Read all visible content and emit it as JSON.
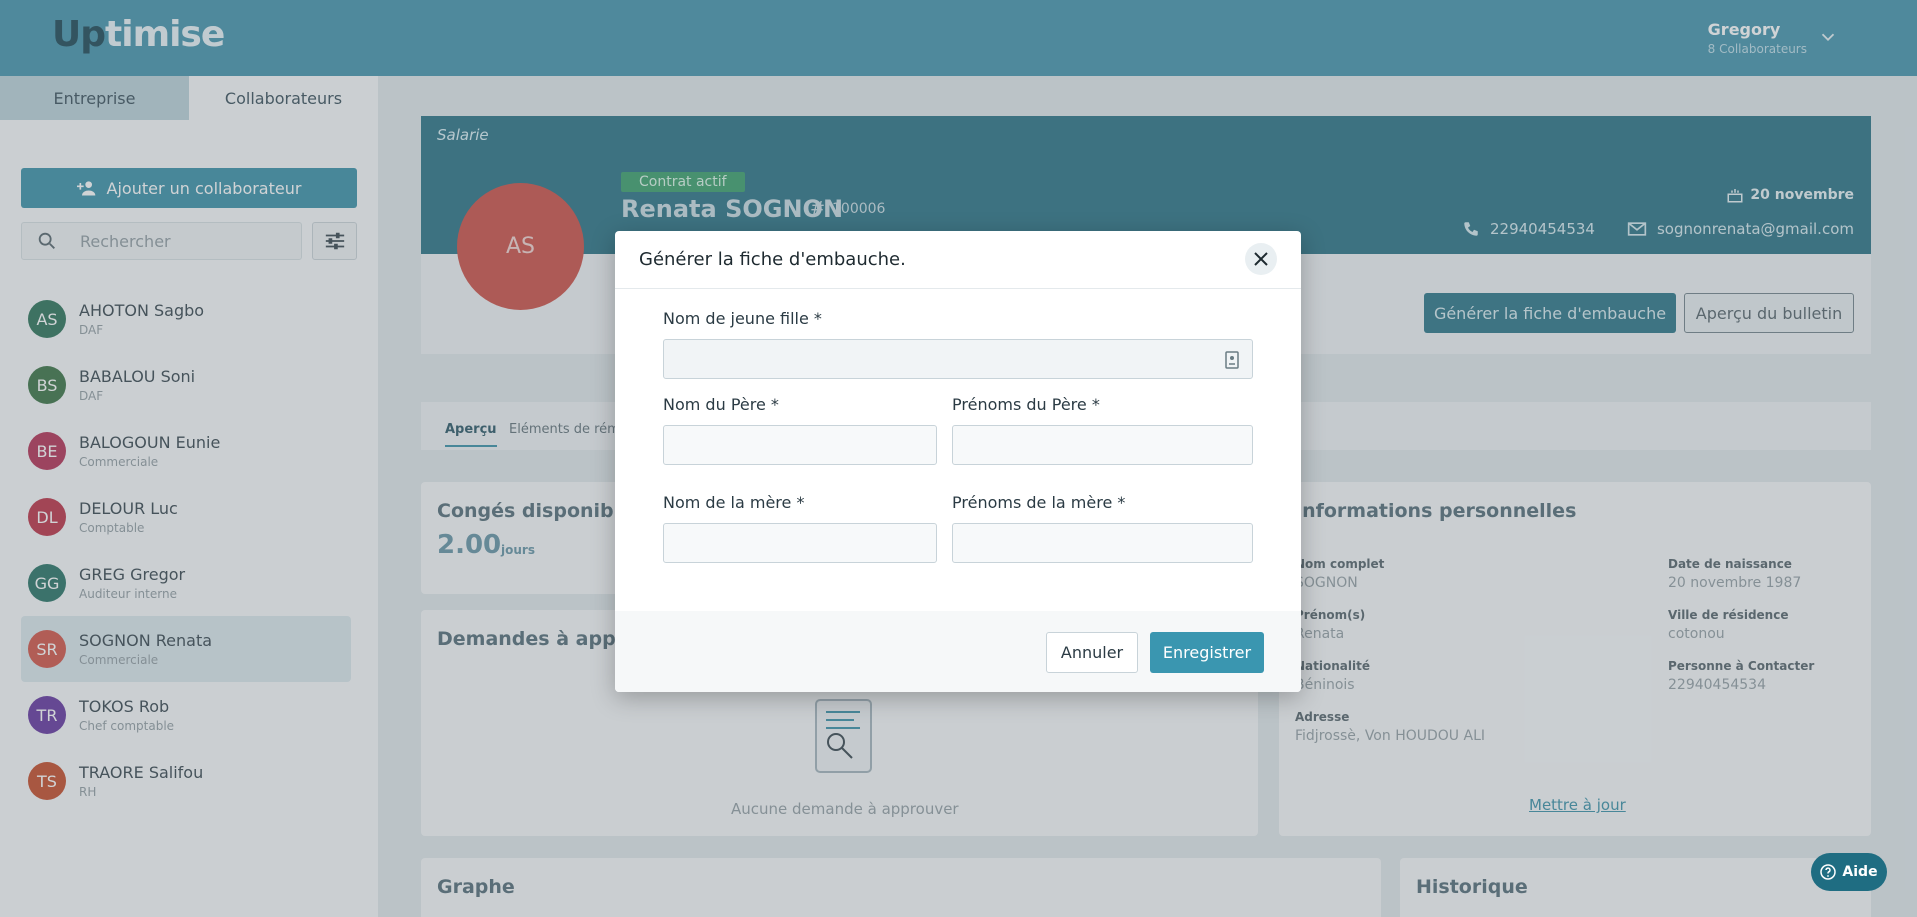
{
  "app": {
    "logo_up": "Up",
    "logo_rest": "timise"
  },
  "user": {
    "name": "Gregory",
    "subtitle": "8 Collaborateurs"
  },
  "sidebar": {
    "tabs": [
      {
        "label": "Entreprise"
      },
      {
        "label": "Collaborateurs"
      }
    ],
    "add_button": "Ajouter un collaborateur",
    "search_placeholder": "Rechercher",
    "employees": [
      {
        "initials": "AS",
        "name": "AHOTON Sagbo",
        "role": "DAF",
        "color": "#1f6b4f"
      },
      {
        "initials": "BS",
        "name": "BABALOU Soni",
        "role": "DAF",
        "color": "#2f6b3a"
      },
      {
        "initials": "BE",
        "name": "BALOGOUN Eunie",
        "role": "Commerciale",
        "color": "#b0244a"
      },
      {
        "initials": "DL",
        "name": "DELOUR Luc",
        "role": "Comptable",
        "color": "#b8253b"
      },
      {
        "initials": "GG",
        "name": "GREG Gregor",
        "role": "Auditeur interne",
        "color": "#1b6b5c"
      },
      {
        "initials": "SR",
        "name": "SOGNON Renata",
        "role": "Commerciale",
        "color": "#d04a3d"
      },
      {
        "initials": "TR",
        "name": "TOKOS Rob",
        "role": "Chef comptable",
        "color": "#5b2a9a"
      },
      {
        "initials": "TS",
        "name": "TRAORE Salifou",
        "role": "RH",
        "color": "#c2411c"
      }
    ]
  },
  "profile": {
    "section_label": "Salarie",
    "initials": "AS",
    "contract_badge": "Contrat actif",
    "name": "Renata SOGNON",
    "hash": "#",
    "id": "100006",
    "birthday": "20 novembre",
    "phone": "22940454534",
    "email": "sognonrenata@gmail.com",
    "generate_button": "Générer la fiche d'embauche",
    "bulletin_button": "Aperçu du bulletin"
  },
  "subtabs": [
    {
      "label": "Aperçu"
    },
    {
      "label": "Eléments de rému"
    }
  ],
  "conges": {
    "title": "Congés disponibles",
    "value": "2.00",
    "unit": "jours"
  },
  "demandes": {
    "title": "Demandes à appro",
    "empty_text": "Aucune demande à approuver"
  },
  "infos": {
    "title": "Informations personnelles",
    "items": [
      {
        "label": "Nom complet",
        "value": "SOGNON"
      },
      {
        "label": "Date de naissance",
        "value": "20 novembre 1987"
      },
      {
        "label": "Prénom(s)",
        "value": "Renata"
      },
      {
        "label": "Ville de résidence",
        "value": "cotonou"
      },
      {
        "label": "Nationalité",
        "value": "Béninois"
      },
      {
        "label": "Personne à Contacter",
        "value": "22940454534"
      },
      {
        "label": "Adresse",
        "value": "Fidjrossè, Von HOUDOU ALI"
      }
    ],
    "update_link": "Mettre à jour"
  },
  "graphe": {
    "title": "Graphe"
  },
  "historique": {
    "title": "Historique"
  },
  "modal": {
    "title": "Générer la fiche d'embauche.",
    "fields": {
      "maiden_name_label": "Nom de jeune fille *",
      "maiden_name_value": "",
      "father_name_label": "Nom du Père *",
      "father_firstnames_label": "Prénoms du Père *",
      "mother_name_label": "Nom de la mère *",
      "mother_firstnames_label": "Prénoms de la mère *"
    },
    "cancel_button": "Annuler",
    "save_button": "Enregistrer"
  },
  "help_button": "Aide",
  "colors": {
    "primary": "#3a8ea8",
    "dark_teal": "#1e6a7e",
    "success": "#2e9a63"
  }
}
